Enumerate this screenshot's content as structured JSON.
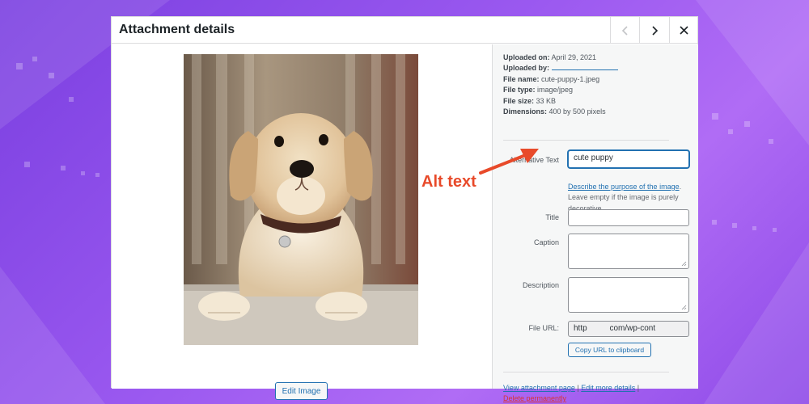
{
  "modal": {
    "title": "Attachment details"
  },
  "header_buttons": {
    "prev_icon": "chevron-left-icon",
    "next_icon": "chevron-right-icon",
    "close_icon": "close-icon"
  },
  "image": {
    "edit_label": "Edit Image"
  },
  "meta": {
    "uploaded_on_label": "Uploaded on:",
    "uploaded_on_value": "April 29, 2021",
    "uploaded_by_label": "Uploaded by:",
    "file_name_label": "File name:",
    "file_name_value": "cute-puppy-1.jpeg",
    "file_type_label": "File type:",
    "file_type_value": "image/jpeg",
    "file_size_label": "File size:",
    "file_size_value": "33 KB",
    "dimensions_label": "Dimensions:",
    "dimensions_value": "400 by 500 pixels"
  },
  "fields": {
    "alt_label": "Alternative Text",
    "alt_value": "cute puppy",
    "alt_help_link": "Describe the purpose of the image",
    "alt_help_text": ". Leave empty if the image is purely decorative.",
    "title_label": "Title",
    "title_value": "",
    "caption_label": "Caption",
    "caption_value": "",
    "description_label": "Description",
    "description_value": "",
    "file_url_label": "File URL:",
    "file_url_value": "http          com/wp-cont",
    "copy_url_label": "Copy URL to clipboard"
  },
  "footer": {
    "view_page": "View attachment page",
    "sep1": " | ",
    "edit_more": "Edit more details",
    "sep2": " |",
    "delete": "Delete permanently"
  },
  "annotation": {
    "text": "Alt text",
    "color": "#e84a2a"
  },
  "colors": {
    "accent": "#2271b1",
    "danger": "#d63638",
    "background": "#9b59f0"
  }
}
